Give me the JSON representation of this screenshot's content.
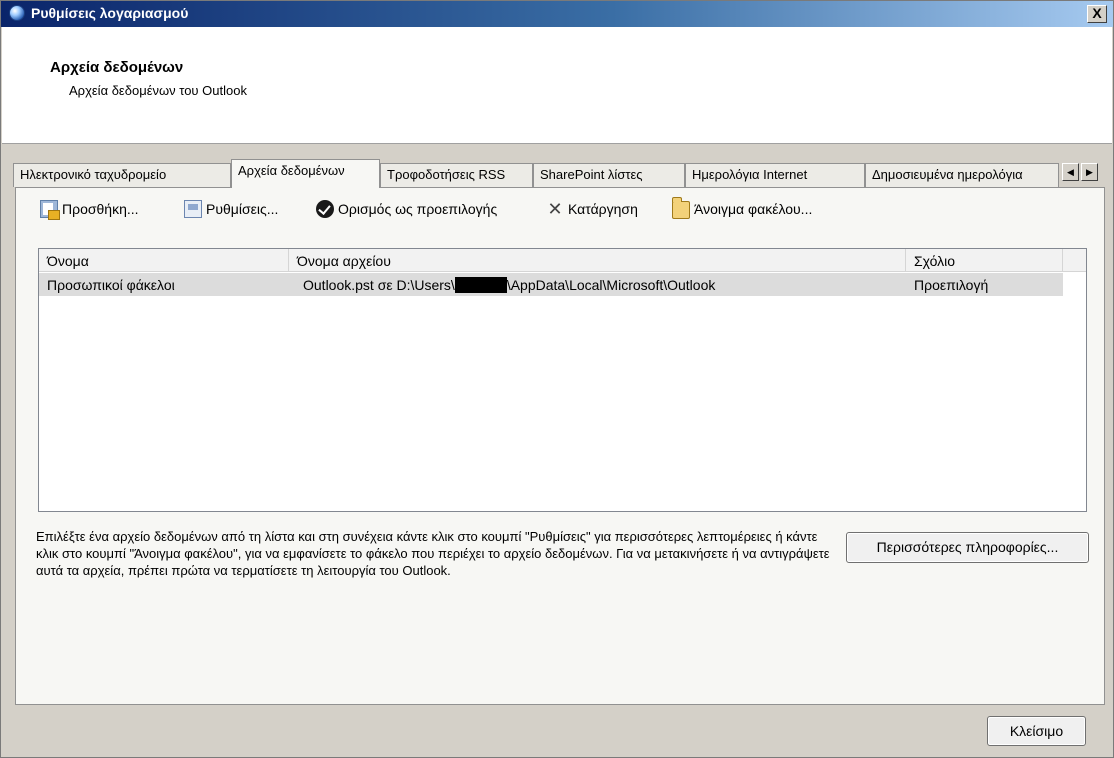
{
  "window": {
    "title": "Ρυθμίσεις λογαριασμού",
    "close_glyph": "X"
  },
  "header": {
    "title": "Αρχεία δεδομένων",
    "subtitle": "Αρχεία δεδομένων του Outlook"
  },
  "tabs": [
    {
      "label": "Ηλεκτρονικό ταχυδρομείο",
      "active": false
    },
    {
      "label": "Αρχεία δεδομένων",
      "active": true
    },
    {
      "label": "Τροφοδοτήσεις RSS",
      "active": false
    },
    {
      "label": "SharePoint λίστες",
      "active": false
    },
    {
      "label": "Ημερολόγια Internet",
      "active": false
    },
    {
      "label": "Δημοσιευμένα ημερολόγια",
      "active": false
    }
  ],
  "tab_scroll": {
    "left": "◀",
    "right": "▶"
  },
  "toolbar": {
    "add": "Προσθήκη...",
    "settings": "Ρυθμίσεις...",
    "set_default": "Ορισμός ως προεπιλογής",
    "remove": "Κατάργηση",
    "remove_glyph": "✕",
    "open_folder": "Άνοιγμα φακέλου..."
  },
  "list": {
    "columns": [
      "Όνομα",
      "Όνομα αρχείου",
      "Σχόλιο"
    ],
    "rows": [
      {
        "name": "Προσωπικοί φάκελοι",
        "file_prefix": "Outlook.pst σε D:\\Users\\",
        "file_suffix": "\\AppData\\Local\\Microsoft\\Outlook",
        "comment": "Προεπιλογή"
      }
    ]
  },
  "description": "Επιλέξτε ένα αρχείο δεδομένων από τη λίστα και στη συνέχεια κάντε κλικ στο κουμπί \"Ρυθμίσεις\" για περισσότερες λεπτομέρειες ή κάντε κλικ στο κουμπί \"Άνοιγμα φακέλου\", για να εμφανίσετε το φάκελο που περιέχει το αρχείο δεδομένων. Για να μετακινήσετε ή να αντιγράψετε αυτά τα αρχεία, πρέπει πρώτα να τερματίσετε τη λειτουργία του Outlook.",
  "buttons": {
    "more_info": "Περισσότερες πληροφορίες...",
    "close": "Κλείσιμο"
  }
}
